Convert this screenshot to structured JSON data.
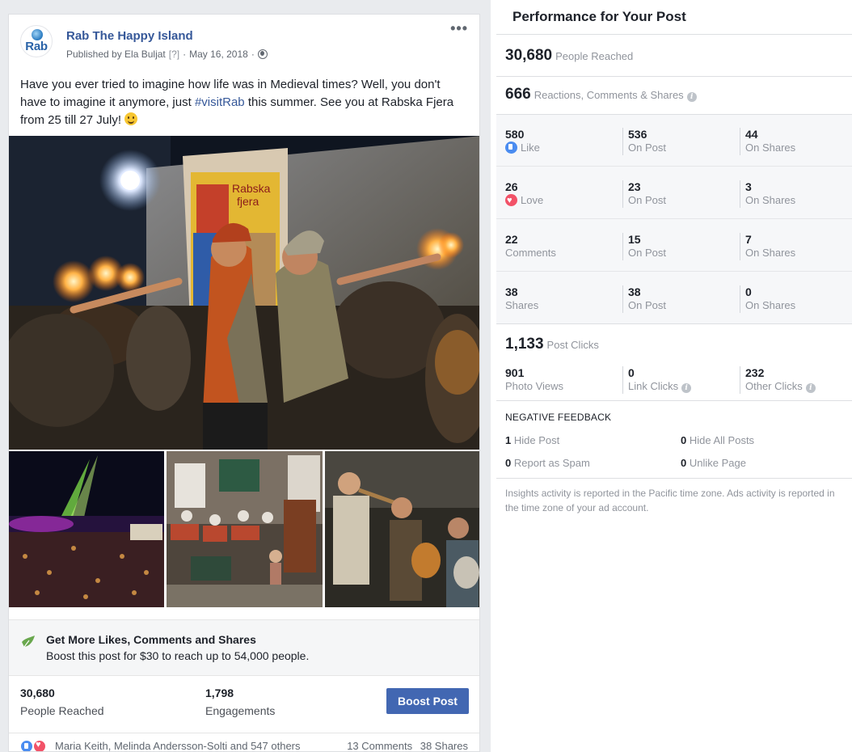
{
  "post": {
    "page_logo_text": "Rab",
    "page_name": "Rab The Happy Island",
    "published_by": "Published by Ela Buljat",
    "help_marker": "[?]",
    "separator": "·",
    "date": "May 16, 2018",
    "more_icon": "more-dots-icon",
    "text_before_tag": "Have you ever tried to imagine how life was in Medieval times? Well, you don't have to imagine it anymore, just ",
    "hashtag": "#visitRab",
    "text_after_tag": " this summer. See you at Rabska Fjera from 25 till 27 July! ",
    "photo_banner_text": [
      "Rabska",
      "fjera"
    ]
  },
  "promo": {
    "title": "Get More Likes, Comments and Shares",
    "subtitle": "Boost this post for $30 to reach up to 54,000 people."
  },
  "stats": {
    "reached_value": "30,680",
    "reached_label": "People Reached",
    "engagements_value": "1,798",
    "engagements_label": "Engagements",
    "boost_button": "Boost Post"
  },
  "reactions": {
    "names": "Maria Keith, Melinda Andersson-Solti and 547 others",
    "comments": "13 Comments",
    "shares": "38 Shares"
  },
  "performance": {
    "title": "Performance for Your Post",
    "people_reached": {
      "value": "30,680",
      "label": "People Reached"
    },
    "reactions_total": {
      "value": "666",
      "label": "Reactions, Comments & Shares"
    },
    "rows": [
      {
        "total": "580",
        "label": "Like",
        "icon": "like-icon",
        "on_post": "536",
        "on_shares": "44"
      },
      {
        "total": "26",
        "label": "Love",
        "icon": "love-icon",
        "on_post": "23",
        "on_shares": "3"
      },
      {
        "total": "22",
        "label": "Comments",
        "on_post": "15",
        "on_shares": "7"
      },
      {
        "total": "38",
        "label": "Shares",
        "on_post": "38",
        "on_shares": "0"
      }
    ],
    "on_post_label": "On Post",
    "on_shares_label": "On Shares",
    "post_clicks": {
      "value": "1,133",
      "label": "Post Clicks"
    },
    "clicks": [
      {
        "value": "901",
        "label": "Photo Views"
      },
      {
        "value": "0",
        "label": "Link Clicks"
      },
      {
        "value": "232",
        "label": "Other Clicks"
      }
    ],
    "negative_title": "NEGATIVE FEEDBACK",
    "negative": [
      {
        "value": "1",
        "label": "Hide Post"
      },
      {
        "value": "0",
        "label": "Hide All Posts"
      },
      {
        "value": "0",
        "label": "Report as Spam"
      },
      {
        "value": "0",
        "label": "Unlike Page"
      }
    ],
    "footnote": "Insights activity is reported in the Pacific time zone. Ads activity is reported in the time zone of your ad account."
  },
  "colors": {
    "link_blue": "#365899",
    "button_blue": "#4267b2",
    "like_blue": "#4a8cf0",
    "love_red": "#f25268",
    "muted_text": "#90949c"
  }
}
